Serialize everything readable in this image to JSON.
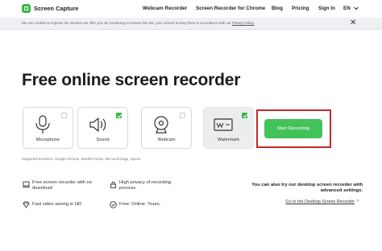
{
  "header": {
    "brand": "Screen Capture",
    "nav": [
      "Webcam Recorder",
      "Screen Recorder for Chrome",
      "Blog",
      "Pricing",
      "Sign In"
    ],
    "language": "EN"
  },
  "cookie_banner": {
    "text": "We use cookies to improve the services we offer you. By continuing to browse this site, you consent to keep them in accordance with our ",
    "link": "Privacy Policy.",
    "close": "✕"
  },
  "main": {
    "title": "Free online screen recorder",
    "options": [
      {
        "label": "Microphone",
        "checked": false
      },
      {
        "label": "Sound",
        "checked": true
      },
      {
        "label": "Webcam",
        "checked": false
      },
      {
        "label": "Watermark",
        "checked": true
      }
    ],
    "start_button": "Start Recording",
    "supported": "Supported browsers: Google Chrome, Mozilla Firefox, Microsoft Edge, Opera."
  },
  "features": {
    "f1": "Free screen recorder with no download",
    "f2": "High privacy of recording process",
    "f3": "Fast video saving in HD",
    "f4": "Free. Online. Yours."
  },
  "desktop": {
    "text": "You can also try our desktop screen recorder with advanced settings.",
    "link": "Go to the Desktop Screen Recorder",
    "arrow": "›"
  },
  "colors": {
    "accent": "#44c25a",
    "highlight_border": "#c62828"
  }
}
